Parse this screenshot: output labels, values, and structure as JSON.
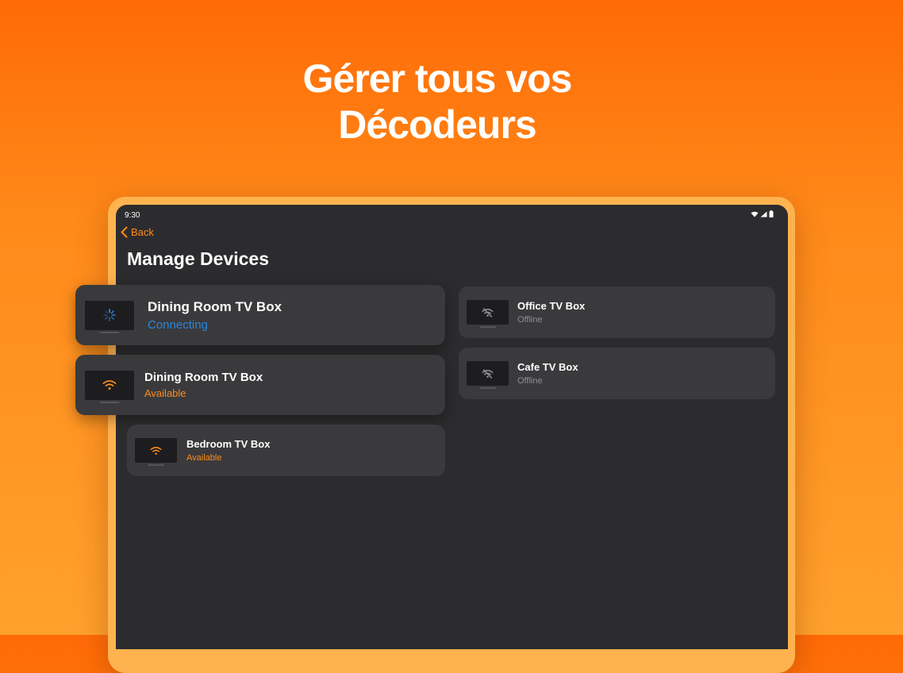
{
  "headline": {
    "line1": "Gérer tous vos",
    "line2": "Décodeurs"
  },
  "status_bar": {
    "time": "9:30",
    "icons": [
      "wifi-icon",
      "cellular-icon",
      "battery-icon"
    ]
  },
  "nav": {
    "back_label": "Back"
  },
  "page": {
    "title": "Manage Devices"
  },
  "devices": [
    {
      "name": "Dining Room TV Box",
      "status": "Connecting",
      "icon": "loading-spinner-icon"
    },
    {
      "name": "Dining Room TV Box",
      "status": "Available",
      "icon": "wifi-icon"
    },
    {
      "name": "Bedroom TV Box",
      "status": "Available",
      "icon": "wifi-icon"
    },
    {
      "name": "Office TV Box",
      "status": "Offline",
      "icon": "wifi-off-icon"
    },
    {
      "name": "Cafe TV Box",
      "status": "Offline",
      "icon": "wifi-off-icon"
    }
  ],
  "colors": {
    "accent": "#ff8c1a",
    "connecting": "#2a86e0",
    "offline": "#8e8e93",
    "screen_bg": "#2c2c2e",
    "card_bg": "#3a3a3c"
  }
}
